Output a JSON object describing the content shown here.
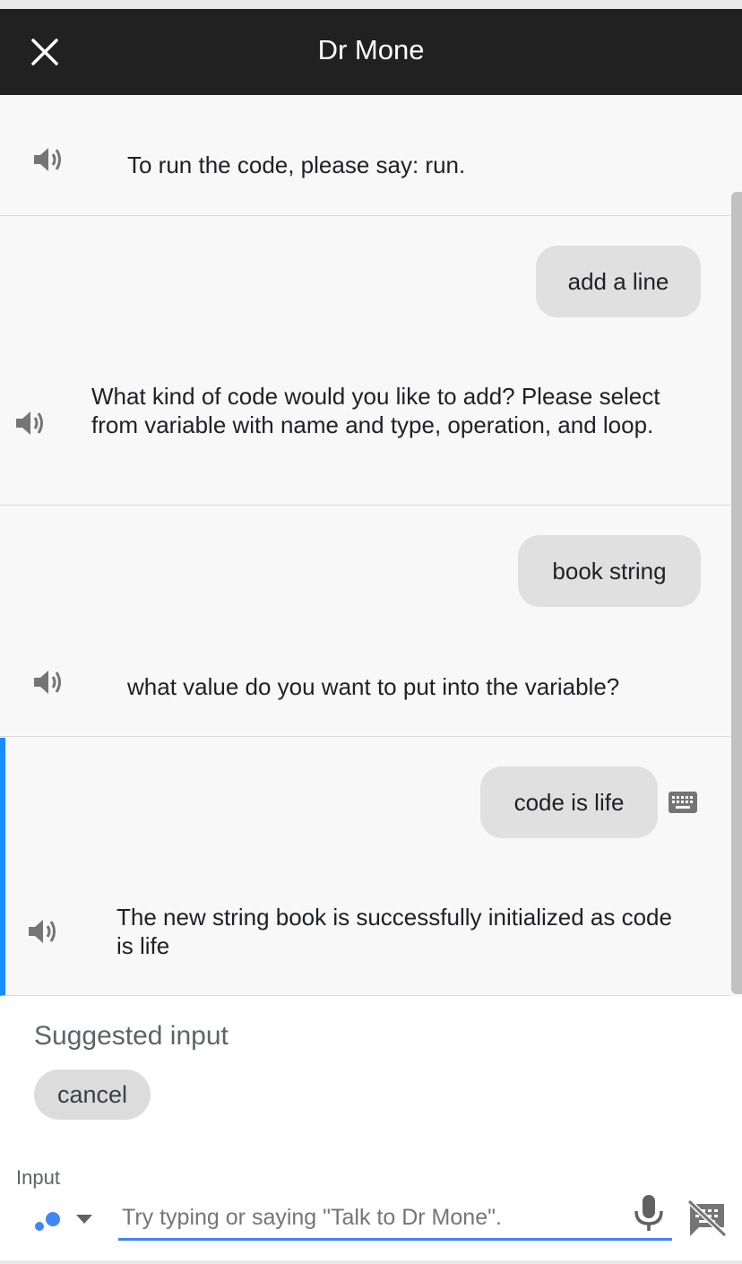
{
  "header": {
    "title": "Dr Mone",
    "close_icon": "close-icon"
  },
  "conversation": {
    "turns": [
      {
        "bot_text": "To run the code, please say: run."
      },
      {
        "user_text": "add a line",
        "bot_text": "What kind of code would you like to add? Please select from variable with name and type, operation, and loop."
      },
      {
        "user_text": "book string",
        "bot_text": "what value do you want to put into the variable?"
      },
      {
        "user_text": "code is life",
        "user_input_icon": "keyboard-icon",
        "bot_text": "The new string book is successfully initialized as code is life",
        "active": true
      }
    ],
    "speaker_icon": "volume-icon",
    "accent_color": "#1a8cff"
  },
  "suggestions": {
    "title": "Suggested input",
    "chips": [
      "cancel"
    ]
  },
  "input": {
    "label": "Input",
    "placeholder": "Try typing or saying \"Talk to Dr Mone\".",
    "value": "",
    "accent_color": "#4285f4",
    "icons": [
      "assistant-dots-icon",
      "chevron-down-icon",
      "microphone-icon",
      "keyboard-off-icon"
    ]
  }
}
